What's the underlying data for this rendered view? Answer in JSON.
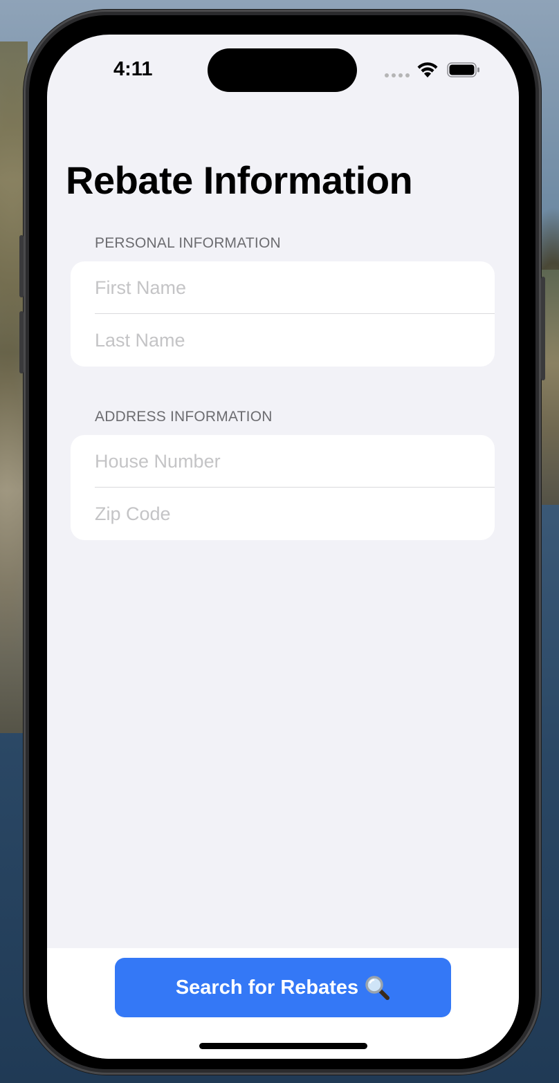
{
  "status_bar": {
    "time": "4:11"
  },
  "title": "Rebate Information",
  "sections": [
    {
      "header": "PERSONAL INFORMATION",
      "fields": [
        {
          "placeholder": "First Name",
          "value": ""
        },
        {
          "placeholder": "Last Name",
          "value": ""
        }
      ]
    },
    {
      "header": "ADDRESS INFORMATION",
      "fields": [
        {
          "placeholder": "House Number",
          "value": ""
        },
        {
          "placeholder": "Zip Code",
          "value": ""
        }
      ]
    }
  ],
  "search_button": {
    "label": "Search for Rebates",
    "icon": "magnifier-icon"
  },
  "colors": {
    "accent": "#3478f6",
    "background": "#f2f2f7",
    "section_header": "#6c6c70",
    "placeholder": "#c4c4c6"
  }
}
